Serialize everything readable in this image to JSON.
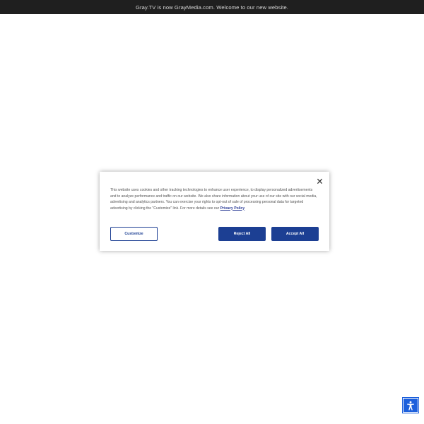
{
  "banner": {
    "text": "Gray.TV is now GrayMedia.com. Welcome to our new website."
  },
  "cookie_dialog": {
    "body_text": "This website uses cookies and other tracking technologies to enhance user experience, to display personalized advertisements and to analyze performance and traffic on our website. We also share information about your use of our site with our social media, advertising and analytics partners. You can exercise your rights to opt-out of sale of processing personal data for targeted advertising by clicking the \"Customize\" link. For more details see our ",
    "policy_link": "Privacy Policy",
    "customize_label": "Customize",
    "reject_label": "Reject All",
    "accept_label": "Accept All",
    "close_icon": "close-icon"
  },
  "accessibility": {
    "icon": "accessibility-icon"
  },
  "colors": {
    "banner_bg": "#1f1f1f",
    "primary_blue": "#1c3f93",
    "link_blue": "#2b3c97",
    "a11y_blue": "#1c5fdc"
  }
}
